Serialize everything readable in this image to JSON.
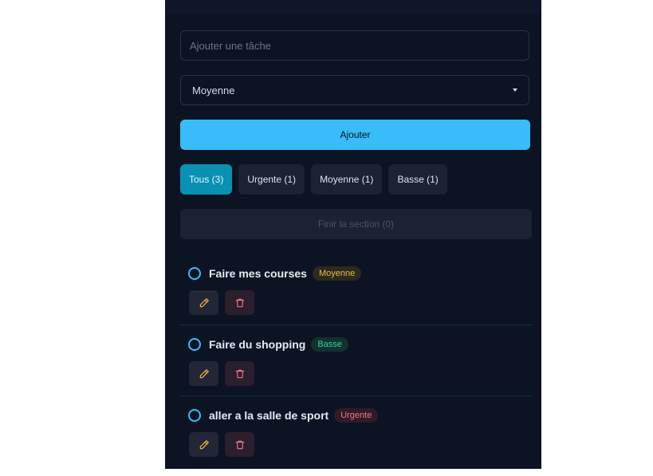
{
  "form": {
    "task_placeholder": "Ajouter une tâche",
    "priority_selected": "Moyenne",
    "add_label": "Ajouter"
  },
  "filters": [
    {
      "label": "Tous (3)",
      "active": true
    },
    {
      "label": "Urgente (1)",
      "active": false
    },
    {
      "label": "Moyenne (1)",
      "active": false
    },
    {
      "label": "Basse (1)",
      "active": false
    }
  ],
  "finish_label": "Finir la section (0)",
  "tasks": [
    {
      "title": "Faire mes courses",
      "priority": "Moyenne"
    },
    {
      "title": "Faire du shopping",
      "priority": "Basse"
    },
    {
      "title": "aller a la salle de sport",
      "priority": "Urgente"
    }
  ],
  "colors": {
    "accent": "#38bdf8",
    "active_filter": "#0891b2",
    "moyenne": "#f6b93b",
    "basse": "#34d399",
    "urgente": "#fb7185",
    "edit_icon": "#f6b93b",
    "delete_icon": "#fb7185"
  },
  "icons": {
    "edit": "pencil-icon",
    "delete": "trash-icon",
    "dropdown": "caret-down-icon"
  }
}
